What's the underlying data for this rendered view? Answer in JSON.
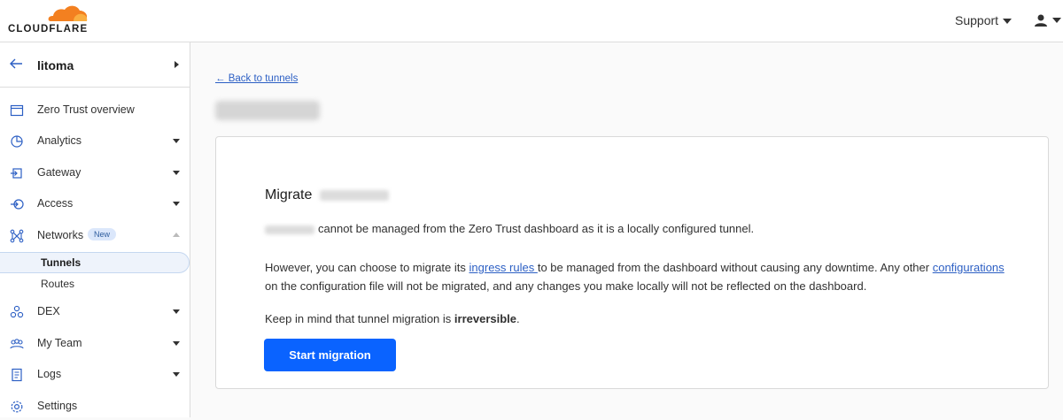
{
  "header": {
    "logo_text": "CLOUDFLARE",
    "support_label": "Support",
    "brand_color": "#f38020"
  },
  "sidebar": {
    "account_name": "litoma",
    "items": [
      {
        "label": "Zero Trust overview",
        "icon": "browser-window-icon"
      },
      {
        "label": "Analytics",
        "icon": "pie-chart-icon"
      },
      {
        "label": "Gateway",
        "icon": "gateway-icon"
      },
      {
        "label": "Access",
        "icon": "access-icon"
      },
      {
        "label": "Networks",
        "icon": "network-icon",
        "badge": "New"
      },
      {
        "label": "DEX",
        "icon": "dex-icon"
      },
      {
        "label": "My Team",
        "icon": "team-icon"
      },
      {
        "label": "Logs",
        "icon": "logs-icon"
      },
      {
        "label": "Settings",
        "icon": "gear-icon"
      }
    ],
    "sub_items": [
      {
        "label": "Tunnels",
        "active": true
      },
      {
        "label": "Routes",
        "active": false
      }
    ]
  },
  "main": {
    "back_link": "← Back to tunnels",
    "card": {
      "title_prefix": "Migrate",
      "p1": "cannot be managed from the Zero Trust dashboard as it is a locally configured tunnel.",
      "p2_before": "However, you can choose to migrate its ",
      "p2_link1": "ingress rules ",
      "p2_middle": "to be managed from the dashboard without causing any downtime. Any other ",
      "p2_link2": "configurations ",
      "p2_after": "on the configuration file will not be migrated, and any changes you make locally will not be reflected on the dashboard.",
      "p3_before": "Keep in mind that tunnel migration is ",
      "p3_bold": "irreversible",
      "p3_after": ".",
      "button_label": "Start migration"
    },
    "accent_color": "#0a63ff"
  }
}
